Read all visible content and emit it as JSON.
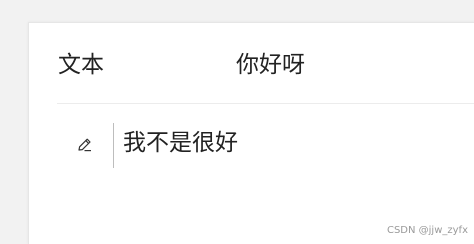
{
  "row": {
    "label": "文本",
    "value": "你好呀"
  },
  "editor": {
    "icon": "pencil-edit-icon",
    "text": "我不是很好"
  },
  "watermark": "CSDN @jjw_zyfx",
  "colors": {
    "background": "#f2f2f2",
    "card": "#ffffff",
    "text": "#222222",
    "divider": "#ececec"
  }
}
